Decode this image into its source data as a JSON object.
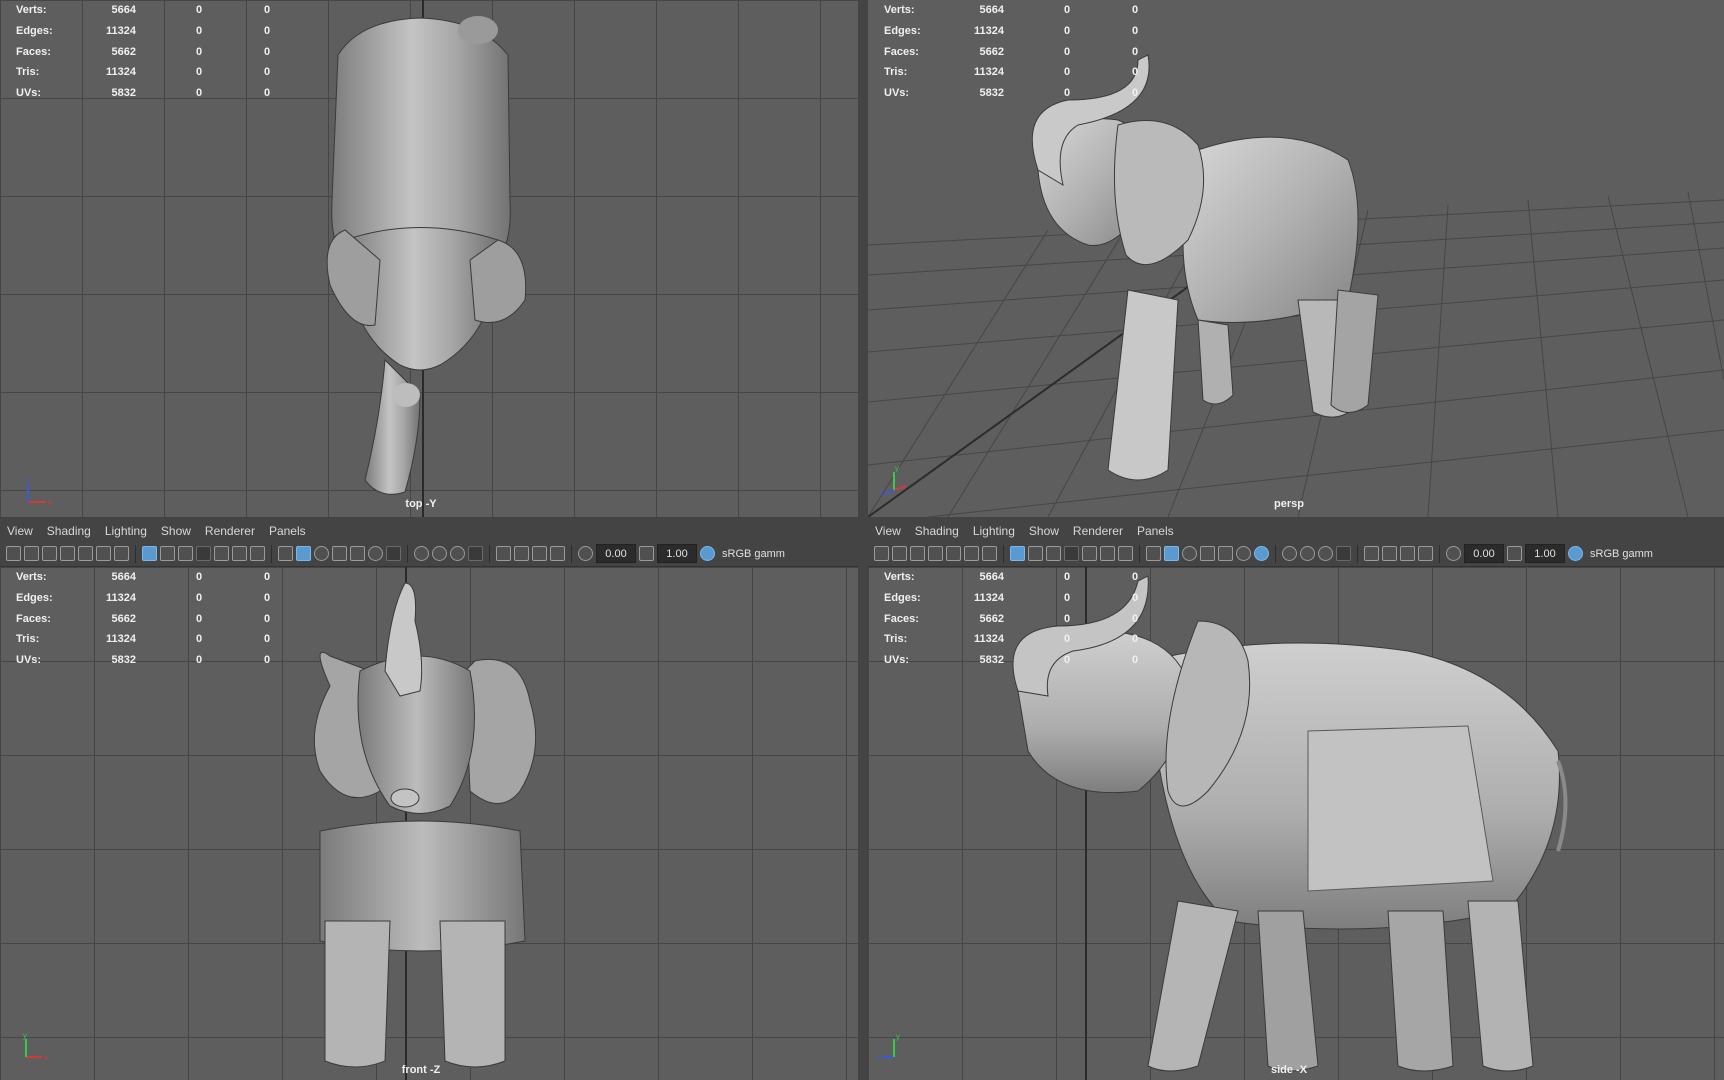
{
  "hud": [
    {
      "label": "Verts:",
      "v1": "5664",
      "v2": "0",
      "v3": "0"
    },
    {
      "label": "Edges:",
      "v1": "11324",
      "v2": "0",
      "v3": "0"
    },
    {
      "label": "Faces:",
      "v1": "5662",
      "v2": "0",
      "v3": "0"
    },
    {
      "label": "Tris:",
      "v1": "11324",
      "v2": "0",
      "v3": "0"
    },
    {
      "label": "UVs:",
      "v1": "5832",
      "v2": "0",
      "v3": "0"
    }
  ],
  "panels": {
    "top_left": {
      "camera": "top -Y"
    },
    "top_right": {
      "camera": "persp"
    },
    "bottom_left": {
      "camera": "front -Z"
    },
    "bottom_right": {
      "camera": "side -X"
    }
  },
  "menu": {
    "view": "View",
    "shading": "Shading",
    "lighting": "Lighting",
    "show": "Show",
    "renderer": "Renderer",
    "panels": "Panels"
  },
  "toolbar": {
    "exposure": "0.00",
    "gamma": "1.00",
    "color_space": "sRGB gamm"
  },
  "gizmo": {
    "x": "x",
    "y": "y",
    "z": "z"
  },
  "colors": {
    "viewport_bg": "#5e5e5e",
    "grid_line": "#454545",
    "model": "#a8a8a8",
    "menubar": "#444444",
    "axis_x": "#d23a3a",
    "axis_y": "#3ac94a",
    "axis_z": "#3a5ad2"
  }
}
